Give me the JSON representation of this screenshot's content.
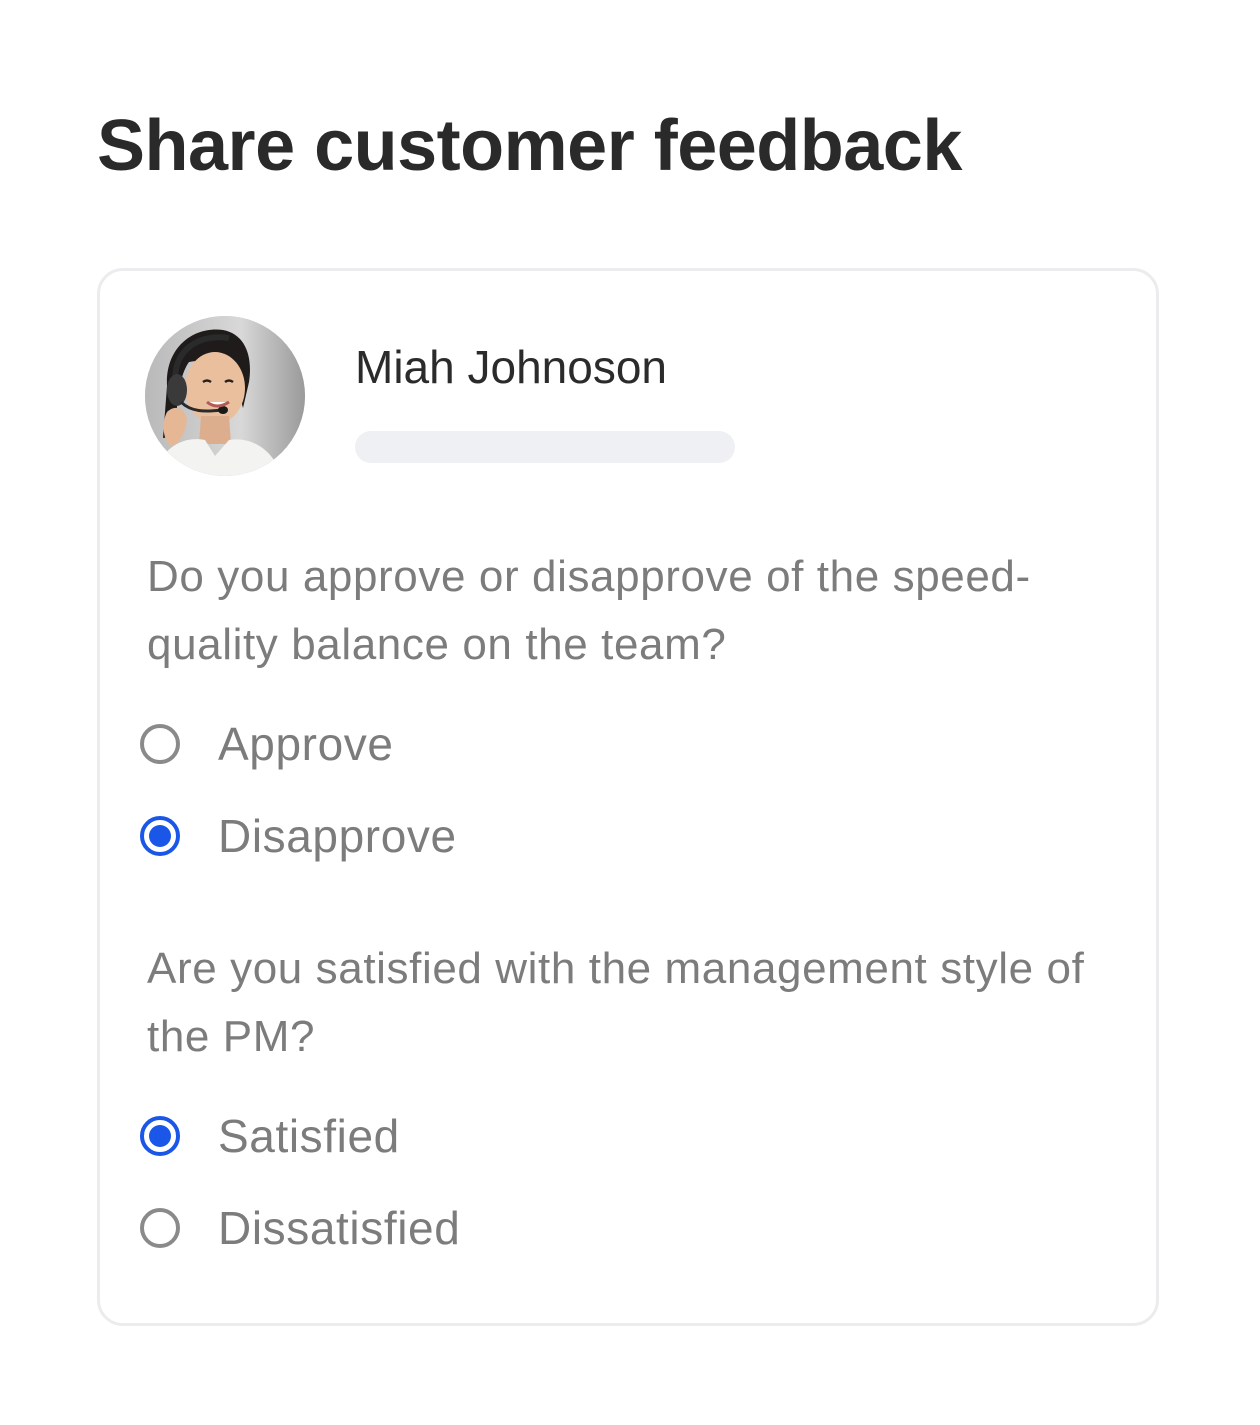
{
  "page": {
    "title": "Share customer feedback"
  },
  "profile": {
    "name": "Miah Johnoson",
    "avatar_icon": "user-photo"
  },
  "colors": {
    "accent": "#1a56e8",
    "muted_text": "#7c7c7c",
    "skeleton": "#eef0f3",
    "border": "#ececee"
  },
  "questions": [
    {
      "text": "Do you approve or disapprove of the speed-quality balance on the team?",
      "options": [
        {
          "label": "Approve",
          "selected": false
        },
        {
          "label": "Disapprove",
          "selected": true
        }
      ]
    },
    {
      "text": "Are you satisfied with the management style of the PM?",
      "options": [
        {
          "label": "Satisfied",
          "selected": true
        },
        {
          "label": "Dissatisfied",
          "selected": false
        }
      ]
    }
  ]
}
